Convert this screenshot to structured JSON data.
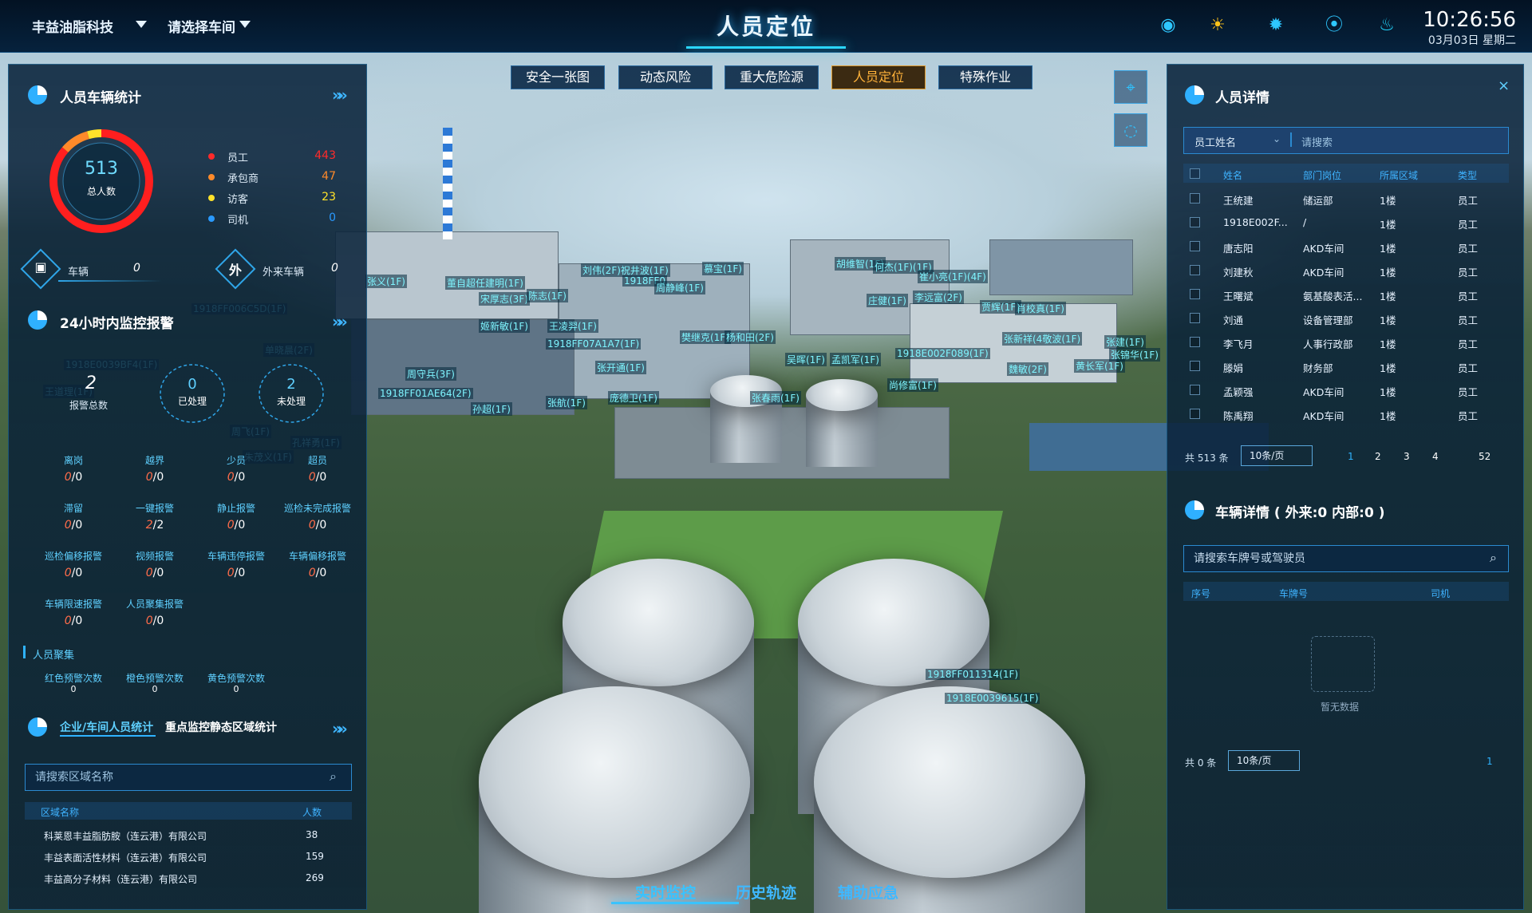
{
  "header": {
    "company_select": "丰益油脂科技",
    "workshop_select": "请选择车间",
    "title": "人员定位",
    "time": "10:26:56",
    "date": "03月03日  星期二",
    "icons": [
      "broadcast-icon",
      "sun-icon",
      "brightness-icon",
      "location-icon",
      "alarm-icon"
    ]
  },
  "nav_tabs": [
    {
      "label": "安全一张图",
      "active": false
    },
    {
      "label": "动态风险",
      "active": false
    },
    {
      "label": "重大危险源",
      "active": false
    },
    {
      "label": "人员定位",
      "active": true
    },
    {
      "label": "特殊作业",
      "active": false
    }
  ],
  "stats_panel": {
    "title": "人员车辆统计",
    "total": "513",
    "total_label": "总人数",
    "legend": [
      {
        "label": "员工",
        "value": "443",
        "color": "#ff2a2a"
      },
      {
        "label": "承包商",
        "value": "47",
        "color": "#ff8a2a"
      },
      {
        "label": "访客",
        "value": "23",
        "color": "#ffe22a"
      },
      {
        "label": "司机",
        "value": "0",
        "color": "#2a9aff"
      }
    ],
    "vehicle_label": "车辆",
    "vehicle_value": "0",
    "external_badge": "外",
    "external_label": "外来车辆",
    "external_value": "0"
  },
  "alarm_panel": {
    "title": "24小时内监控报警",
    "total_value": "2",
    "total_label": "报警总数",
    "handled_value": "0",
    "handled_label": "已处理",
    "unhandled_value": "2",
    "unhandled_label": "未处理",
    "items": [
      {
        "label": "离岗",
        "value": "0",
        "total": "/0"
      },
      {
        "label": "越界",
        "value": "0",
        "total": "/0"
      },
      {
        "label": "少员",
        "value": "0",
        "total": "/0"
      },
      {
        "label": "超员",
        "value": "0",
        "total": "/0"
      },
      {
        "label": "滞留",
        "value": "0",
        "total": "/0"
      },
      {
        "label": "一键报警",
        "value": "2",
        "total": "/2"
      },
      {
        "label": "静止报警",
        "value": "0",
        "total": "/0"
      },
      {
        "label": "巡检未完成报警",
        "value": "0",
        "total": "/0"
      },
      {
        "label": "巡检偏移报警",
        "value": "0",
        "total": "/0"
      },
      {
        "label": "视频报警",
        "value": "0",
        "total": "/0"
      },
      {
        "label": "车辆违停报警",
        "value": "0",
        "total": "/0"
      },
      {
        "label": "车辆偏移报警",
        "value": "0",
        "total": "/0"
      },
      {
        "label": "车辆限速报警",
        "value": "0",
        "total": "/0"
      },
      {
        "label": "人员聚集报警",
        "value": "0",
        "total": "/0"
      }
    ],
    "gather_title": "人员聚集",
    "gather_items": [
      {
        "label": "红色预警次数",
        "value": "0"
      },
      {
        "label": "橙色预警次数",
        "value": "0"
      },
      {
        "label": "黄色预警次数",
        "value": "0"
      }
    ]
  },
  "area_panel": {
    "tab_active": "企业/车间人员统计",
    "tab_other": "重点监控静态区域统计",
    "search_placeholder": "请搜索区域名称",
    "col_name": "区域名称",
    "col_count": "人数",
    "rows": [
      {
        "name": "科莱恩丰益脂肪胺（连云港）有限公司",
        "count": "38"
      },
      {
        "name": "丰益表面活性材料（连云港）有限公司",
        "count": "159"
      },
      {
        "name": "丰益高分子材料（连云港）有限公司",
        "count": "269"
      }
    ]
  },
  "person_panel": {
    "title": "人员详情",
    "filter_select": "员工姓名",
    "search_placeholder": "请搜索",
    "columns": [
      "姓名",
      "部门岗位",
      "所属区域",
      "类型"
    ],
    "rows": [
      {
        "name": "王统建",
        "dept": "储运部",
        "area": "1楼",
        "type": "员工"
      },
      {
        "name": "1918E002F...",
        "dept": "/",
        "area": "1楼",
        "type": "员工"
      },
      {
        "name": "唐志阳",
        "dept": "AKD车间",
        "area": "1楼",
        "type": "员工"
      },
      {
        "name": "刘建秋",
        "dept": "AKD车间",
        "area": "1楼",
        "type": "员工"
      },
      {
        "name": "王曙斌",
        "dept": "氨基酸表活...",
        "area": "1楼",
        "type": "员工"
      },
      {
        "name": "刘通",
        "dept": "设备管理部",
        "area": "1楼",
        "type": "员工"
      },
      {
        "name": "李飞月",
        "dept": "人事行政部",
        "area": "1楼",
        "type": "员工"
      },
      {
        "name": "滕娟",
        "dept": "财务部",
        "area": "1楼",
        "type": "员工"
      },
      {
        "name": "孟颖强",
        "dept": "AKD车间",
        "area": "1楼",
        "type": "员工"
      },
      {
        "name": "陈禹翔",
        "dept": "AKD车间",
        "area": "1楼",
        "type": "员工"
      }
    ],
    "total_text": "共 513 条",
    "page_size": "10条/页",
    "pages": [
      "1",
      "2",
      "3",
      "4",
      "52"
    ]
  },
  "vehicle_panel": {
    "title": "车辆详情 ( 外来:0 内部:0 )",
    "search_placeholder": "请搜索车牌号或驾驶员",
    "columns": [
      "序号",
      "车牌号",
      "司机"
    ],
    "empty_text": "暂无数据",
    "total_text": "共 0 条",
    "page_size": "10条/页",
    "page": "1"
  },
  "bottom_tabs": [
    {
      "label": "实时监控",
      "active": true
    },
    {
      "label": "历史轨迹",
      "active": false
    },
    {
      "label": "辅助应急",
      "active": false
    }
  ],
  "map_tags": [
    "张义(1F)",
    "董自超任建明(1F)",
    "宋厚志(3F)",
    "刘伟(2F)祝井波(1F)",
    "1918FF0",
    "周静峰(1F)",
    "慕宝(1F)",
    "胡维智(1F)",
    "何杰(1F)(1F)",
    "崔小亮(1F)(4F)",
    "1918FF006C5D(1F)",
    "陈志(1F)",
    "姬新敏(1F)",
    "王凌羿(1F)",
    "1918FF07A1A7(1F)",
    "樊继克(1F)",
    "杨和田(2F)",
    "庄健(1F)",
    "李远富(2F)",
    "贾辉(1F)",
    "肖校真(1F)",
    "单晓晨(2F)",
    "1918E0039BF4(1F)",
    "周守兵(3F)",
    "张开通(1F)",
    "吴晖(1F)",
    "孟凯军(1F)",
    "1918E002F089(1F)",
    "张新祥(4敬波(1F)",
    "张建(1F)",
    "张锦华(1F)",
    "1918FF01AE64(2F)",
    "孙超(1F)",
    "张航(1F)",
    "庞德卫(1F)",
    "张春雨(1F)",
    "尚修富(1F)",
    "魏敏(2F)",
    "黄长军(1F)",
    "1918FF011314(1F)",
    "1918E0039615(1F)",
    "王道理(1F)",
    "周飞(1F)",
    "孔祥勇(1F)",
    "朱茂义(1F)"
  ]
}
